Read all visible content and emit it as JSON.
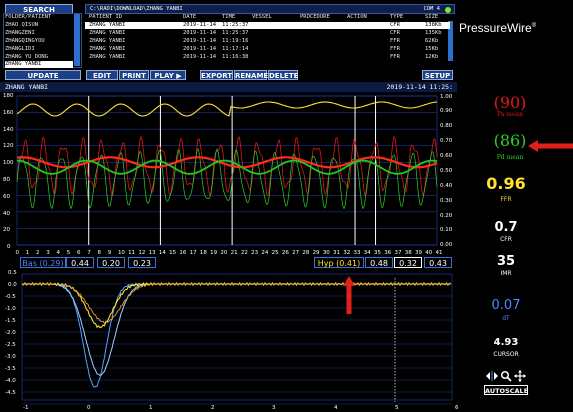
{
  "toolbar": {
    "search": "SEARCH",
    "path": "C:\\RADI\\DOWNLOAD\\ZHANG YANBI",
    "com": "COM 4",
    "update": "UPDATE",
    "edit": "EDIT",
    "print": "PRINT",
    "play": "PLAY ▶",
    "export": "EXPORT",
    "rename": "RENAME",
    "delete": "DELETE",
    "setup": "SETUP"
  },
  "patients": {
    "header": "FOLDER/PATIENT",
    "items": [
      "ZHAO QISUN",
      "ZHANGZENI",
      "ZHANGQINGYOU",
      "ZHANGLIDI",
      "ZHANG YU DONG",
      "ZHANG YANBI"
    ]
  },
  "table": {
    "headers": [
      "PATIENT ID",
      "DATE",
      "TIME",
      "VESSEL",
      "PROCEDURE",
      "ACTION",
      "TYPE",
      "SIZE"
    ],
    "rows": [
      [
        "ZHANG YANBI",
        "2019-11-14",
        "11:25:37",
        "",
        "",
        "",
        "CFR",
        "138Kb"
      ],
      [
        "ZHANG YANBI",
        "2019-11-14",
        "11:25:37",
        "",
        "",
        "",
        "CFR",
        "135Kb"
      ],
      [
        "ZHANG YANBI",
        "2019-11-14",
        "11:19:16",
        "",
        "",
        "",
        "FFR",
        "62Kb"
      ],
      [
        "ZHANG YANBI",
        "2019-11-14",
        "11:17:14",
        "",
        "",
        "",
        "FFR",
        "15Kb"
      ],
      [
        "ZHANG YANBI",
        "2019-11-14",
        "11:16:38",
        "",
        "",
        "",
        "FFR",
        "12Kb"
      ]
    ]
  },
  "brand": "PressureWire",
  "brand_mark": "®",
  "top_chart": {
    "title": "ZHANG YANBI",
    "timestamp": "2019-11-14 11:25:",
    "left_ticks": [
      "180",
      "160",
      "140",
      "120",
      "100",
      "80",
      "60",
      "40",
      "20",
      "0"
    ],
    "right_ticks": [
      "1.00",
      "0.90",
      "0.80",
      "0.70",
      "0.60",
      "0.50",
      "0.40",
      "0.30",
      "0.20",
      "0.10",
      "0.00"
    ],
    "x_ticks": [
      "0",
      "1",
      "2",
      "3",
      "4",
      "5",
      "6",
      "7",
      "8",
      "9",
      "10",
      "11",
      "12",
      "13",
      "14",
      "15",
      "16",
      "17",
      "18",
      "19",
      "20",
      "21",
      "22",
      "23",
      "24",
      "25",
      "26",
      "27",
      "28",
      "29",
      "30",
      "31",
      "32",
      "33",
      "34",
      "35",
      "36",
      "37",
      "38",
      "39",
      "40",
      "41"
    ]
  },
  "readouts": {
    "bas_label": "Bas (0.29)",
    "bas_values": [
      "0.44",
      "0.20",
      "0.23"
    ],
    "hyp_label": "Hyp (0.41)",
    "hyp_values": [
      "0.48",
      "0.32",
      "0.43"
    ]
  },
  "bottom_chart": {
    "y_ticks": [
      "0.5",
      "0.0",
      "-0.5",
      "-1.0",
      "-1.5",
      "-2.0",
      "-2.5",
      "-3.0",
      "-3.5",
      "-4.0",
      "-4.5"
    ],
    "x_ticks": [
      "-1",
      "0",
      "1",
      "2",
      "3",
      "4",
      "5",
      "6"
    ]
  },
  "right_panel": {
    "pa_value": "(90)",
    "pa_label": "Pa mean",
    "pd_value": "(86)",
    "pd_label": "Pd mean",
    "ffr_value": "0.96",
    "ffr_label": "FFR",
    "cfr_value": "0.7",
    "cfr_label": "CFR",
    "imr_value": "35",
    "imr_label": "IMR",
    "dt_value": "0.07",
    "dt_label": "dT",
    "cursor_value": "4.93",
    "cursor_label": "CURSOR",
    "autoscale": "AUTOSCALE"
  },
  "colors": {
    "pa": "#e01818",
    "pd": "#2bd12b",
    "ffr": "#ffe12e",
    "dt": "#4f86ff",
    "annotation_arrow": "#e0201a"
  }
}
